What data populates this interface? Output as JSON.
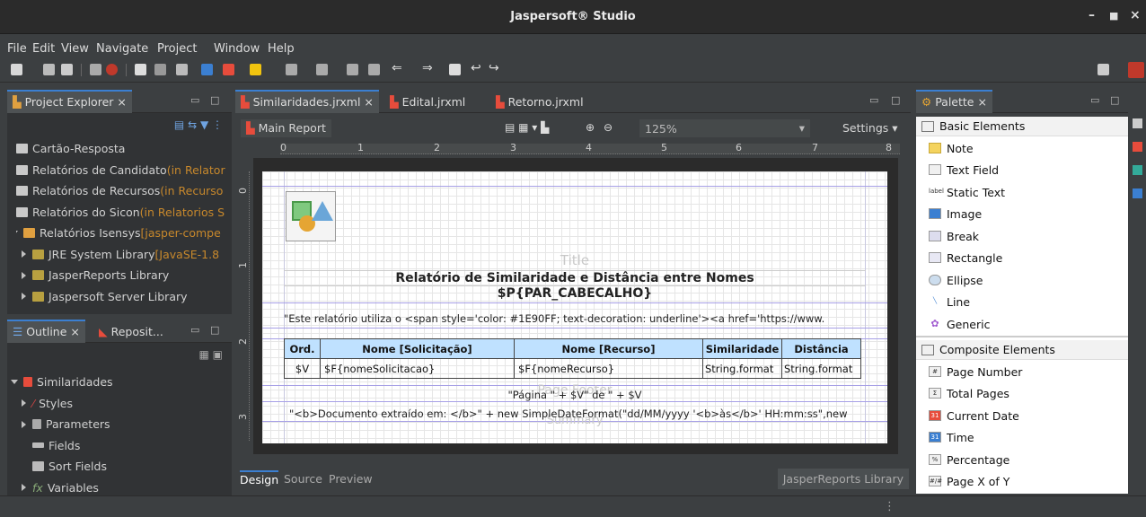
{
  "window": {
    "title": "Jaspersoft® Studio"
  },
  "menu": [
    "File",
    "Edit",
    "View",
    "Navigate",
    "Project",
    "Window",
    "Help"
  ],
  "project_explorer": {
    "tab": "Project Explorer",
    "items": [
      {
        "label": "Cartão-Resposta",
        "suffix": ""
      },
      {
        "label": "Relatórios de Candidato",
        "suffix": " (in Relator"
      },
      {
        "label": "Relatórios de Recursos",
        "suffix": " (in Recurso"
      },
      {
        "label": "Relatórios do Sicon",
        "suffix": " (in Relatorios S"
      },
      {
        "label": "Relatórios Isensys",
        "suffix": " [jasper-compe"
      },
      {
        "label": "JRE System Library",
        "suffix": " [JavaSE-1.8"
      },
      {
        "label": "JasperReports Library",
        "suffix": ""
      },
      {
        "label": "Jaspersoft Server Library",
        "suffix": ""
      }
    ]
  },
  "outline": {
    "tab": "Outline",
    "tab2": "Reposit...",
    "items": [
      "Similaridades",
      "Styles",
      "Parameters",
      "Fields",
      "Sort Fields",
      "Variables"
    ]
  },
  "editor": {
    "tabs": [
      "Similaridades.jrxml",
      "Edital.jrxml",
      "Retorno.jrxml"
    ],
    "main_report": "Main Report",
    "zoom": "125%",
    "settings": "Settings",
    "ruler": [
      "0",
      "1",
      "2",
      "3",
      "4",
      "5",
      "6",
      "7",
      "8"
    ],
    "bottom_tabs": [
      "Design",
      "Source",
      "Preview"
    ],
    "library": "JasperReports Library"
  },
  "report": {
    "title_watermark": "Title",
    "title_line1": "Relatório de Similaridade e Distância entre Nomes",
    "title_line2": "$P{PAR_CABECALHO}",
    "html_text": "\"Este relatório utiliza o <span style='color: #1E90FF; text-decoration: underline'><a href='https://www.",
    "table_headers": [
      "Ord.",
      "Nome [Solicitação]",
      "Nome [Recurso]",
      "Similaridade",
      "Distância"
    ],
    "table_row": [
      "$V",
      "$F{nomeSolicitacao}",
      "$F{nomeRecurso}",
      "String.format",
      "String.format"
    ],
    "page_footer_watermark": "Page Footer",
    "page_text": "\"Página \" + $V\" de \" + $V",
    "summary_watermark": "Summary",
    "footer_text": "\"<b>Documento extraído em: </b>\" + new SimpleDateFormat(\"dd/MM/yyyy '<b>às</b>' HH:mm:ss\",new"
  },
  "palette": {
    "tab": "Palette",
    "basic_header": "Basic Elements",
    "basic": [
      "Note",
      "Text Field",
      "Static Text",
      "Image",
      "Break",
      "Rectangle",
      "Ellipse",
      "Line",
      "Generic"
    ],
    "composite_header": "Composite Elements",
    "composite": [
      "Page Number",
      "Total Pages",
      "Current Date",
      "Time",
      "Percentage",
      "Page X of Y"
    ]
  },
  "colors": {
    "accent": "#3b7fd1",
    "table_header": "#bfe1ff",
    "band_line": "#a7a0e6"
  }
}
